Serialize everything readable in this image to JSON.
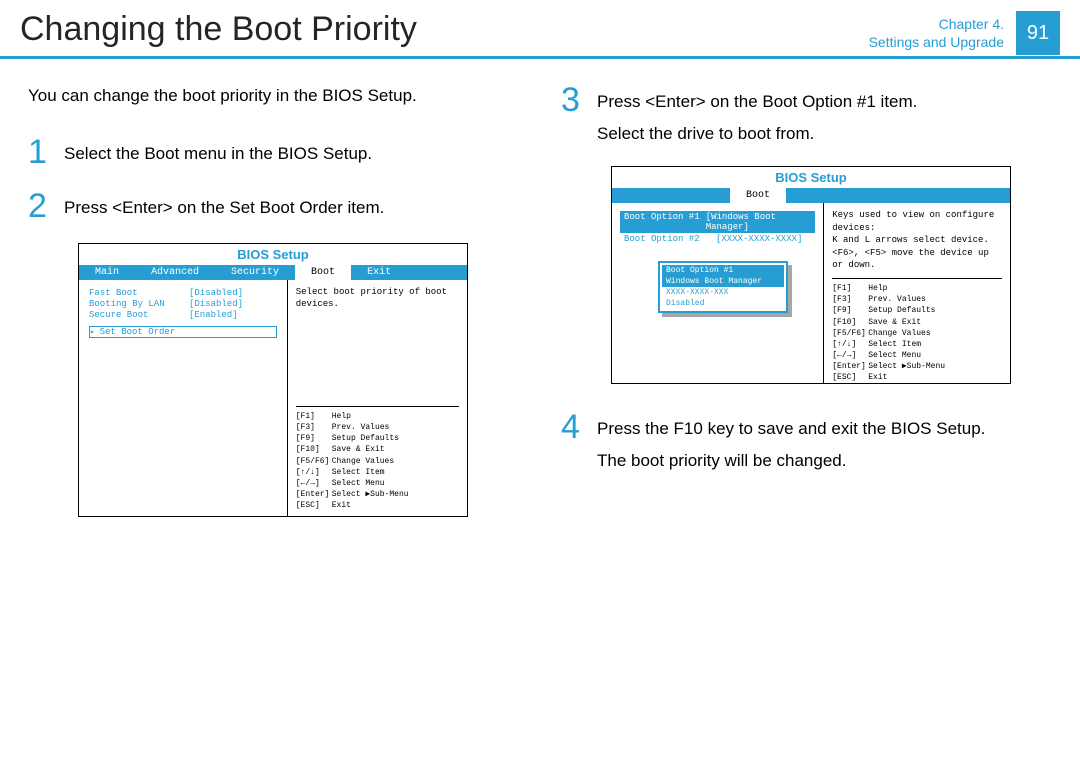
{
  "header": {
    "title": "Changing the Boot Priority",
    "chapter_line1": "Chapter 4.",
    "chapter_line2": "Settings and Upgrade",
    "page": "91"
  },
  "left": {
    "intro": "You can change the boot priority in the BIOS Setup.",
    "step1_num": "1",
    "step1_a": "Select the ",
    "step1_b": "Boot",
    "step1_c": " menu in the BIOS Setup.",
    "step2_num": "2",
    "step2_a": "Press <Enter> on the ",
    "step2_b": "Set Boot Order",
    "step2_c": " item."
  },
  "right": {
    "step3_num": "3",
    "step3_a": "Press <Enter> on the ",
    "step3_b": "Boot Option #1",
    "step3_c": " item.",
    "step3_d": "Select the drive to boot from.",
    "step4_num": "4",
    "step4_a": "Press the ",
    "step4_b": "F10",
    "step4_c": " key to save and exit the BIOS Setup.",
    "step4_d": "The boot priority will be changed."
  },
  "bios_generic": {
    "title": "BIOS Setup",
    "tabs": {
      "main": "Main",
      "advanced": "Advanced",
      "security": "Security",
      "boot": "Boot",
      "exit": "Exit"
    },
    "keys": {
      "F1": "Help",
      "F3": "Prev. Values",
      "F9": "Setup Defaults",
      "F10": "Save & Exit",
      "F5F6": "Change Values",
      "UD": "Select Item",
      "LR": "Select Menu",
      "Enter": "Select ▶Sub-Menu",
      "ESC": "Exit"
    },
    "key_labels": {
      "F1": "[F1]",
      "F3": "[F3]",
      "F9": "[F9]",
      "F10": "[F10]",
      "F5F6": "[F5/F6]",
      "UD": "[↑/↓]",
      "LR": "[←/→]",
      "Enter": "[Enter]",
      "ESC": "[ESC]"
    }
  },
  "bios1": {
    "help": "Select boot priority of boot devices.",
    "settings": {
      "fastboot_lbl": "Fast Boot",
      "fastboot_val": "[Disabled]",
      "lan_lbl": "Booting By LAN",
      "lan_val": "[Disabled]",
      "secure_lbl": "Secure Boot",
      "secure_val": "[Enabled]",
      "setboot": "Set Boot Order"
    }
  },
  "bios2": {
    "help": "Keys used to view on configure devices:\n K and L arrows select device.\n<F6>, <F5> move the device up or down.",
    "options": {
      "o1_lbl": "Boot Option #1",
      "o1_val": "[Windows Boot Manager]",
      "o2_lbl": "Boot Option #2",
      "o2_val": "[XXXX-XXXX-XXXX]"
    },
    "popup": {
      "title": "Boot Option #1",
      "i1": "Windows Boot Manager",
      "i2": "XXXX-XXXX-XXX",
      "i3": "Disabled"
    }
  }
}
